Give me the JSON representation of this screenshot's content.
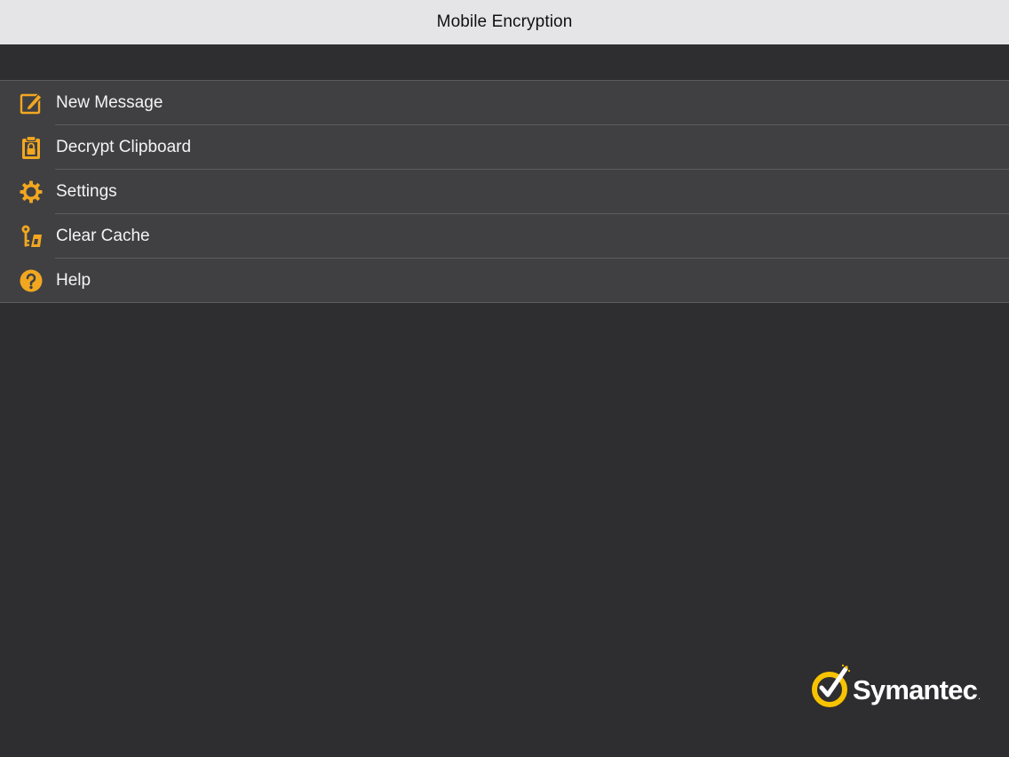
{
  "nav": {
    "title": "Mobile Encryption"
  },
  "menu": {
    "items": [
      {
        "label": "New Message",
        "icon": "compose-icon"
      },
      {
        "label": "Decrypt Clipboard",
        "icon": "clipboard-lock-icon"
      },
      {
        "label": "Settings",
        "icon": "gear-icon"
      },
      {
        "label": "Clear Cache",
        "icon": "broom-key-icon"
      },
      {
        "label": "Help",
        "icon": "help-icon"
      }
    ]
  },
  "brand": {
    "name": "Symantec",
    "logo_icon": "symantec-checkmark-icon"
  },
  "colors": {
    "accent": "#f2a720",
    "nav_background": "#e5e4e7",
    "background": "#2e2d2f",
    "row_background": "#404042"
  }
}
